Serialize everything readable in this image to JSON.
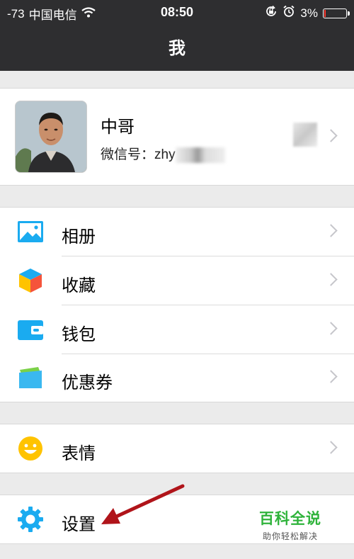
{
  "status_bar": {
    "signal": "-73",
    "carrier": "中国电信",
    "time": "08:50",
    "battery_percent": "3%",
    "battery_level": 0.03,
    "battery_color": "#ff3b30"
  },
  "nav": {
    "title": "我"
  },
  "profile": {
    "name": "中哥",
    "wechat_id_label": "微信号：",
    "wechat_id_visible": "zhy"
  },
  "menu_group_1": [
    {
      "label": "相册",
      "icon": "photo-album-icon"
    },
    {
      "label": "收藏",
      "icon": "favorites-cube-icon"
    },
    {
      "label": "钱包",
      "icon": "wallet-icon"
    },
    {
      "label": "优惠券",
      "icon": "coupon-icon"
    }
  ],
  "menu_group_2": [
    {
      "label": "表情",
      "icon": "smiley-icon"
    }
  ],
  "menu_group_3": [
    {
      "label": "设置",
      "icon": "gear-icon"
    }
  ],
  "watermark": {
    "title": "百科全说",
    "subtitle": "助你轻松解决"
  },
  "colors": {
    "nav_background": "#2e2e30",
    "page_background": "#ebebeb",
    "icon_blue": "#1aabf0",
    "watermark_green": "#2fb33b",
    "annotation_arrow": "#b0141a"
  }
}
